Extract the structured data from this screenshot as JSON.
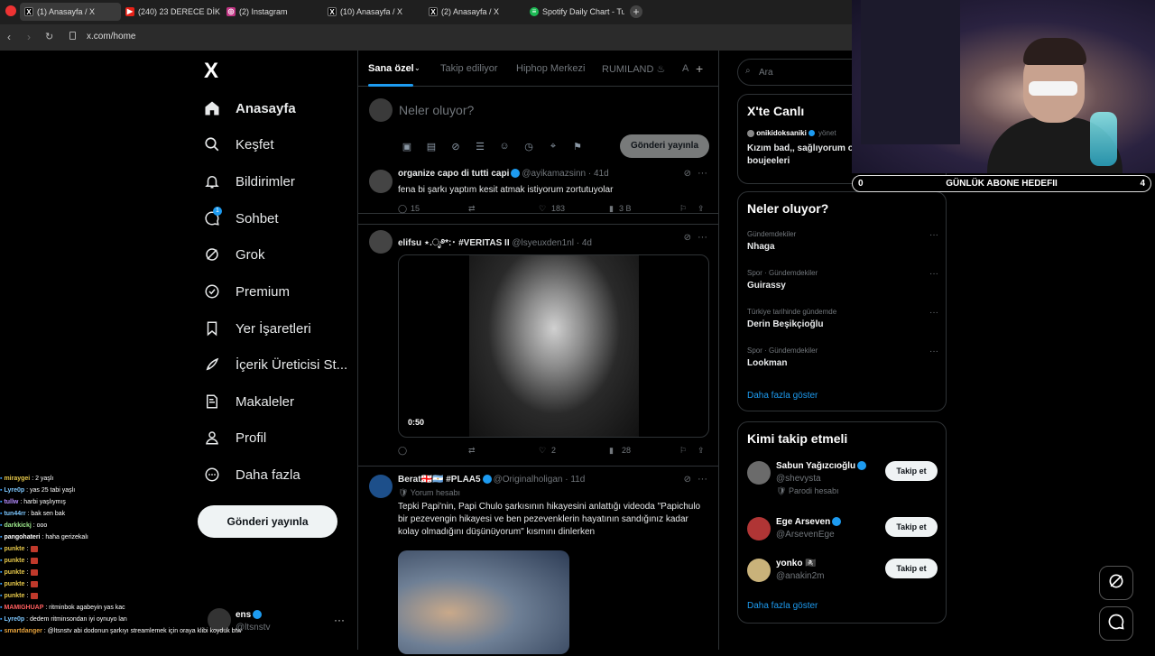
{
  "browser": {
    "tabs": [
      {
        "label": "(1) Anasayfa / X",
        "icon": "x-logo",
        "active": true
      },
      {
        "label": "(240) 23 DERECE DİKİLİTAŞ",
        "icon": "youtube-icon"
      },
      {
        "label": "(2) Instagram",
        "icon": "instagram-icon"
      },
      {
        "label": "(10) Anasayfa / X",
        "icon": "x-logo"
      },
      {
        "label": "(2) Anasayfa / X",
        "icon": "x-logo"
      },
      {
        "label": "Spotify Daily Chart - Turke",
        "icon": "spotify-icon"
      }
    ],
    "url": "x.com/home"
  },
  "nav": {
    "logo": "X",
    "items": [
      {
        "label": "Anasayfa",
        "icon": "home-icon"
      },
      {
        "label": "Keşfet",
        "icon": "search-icon"
      },
      {
        "label": "Bildirimler",
        "icon": "bell-icon"
      },
      {
        "label": "Sohbet",
        "icon": "chat-icon",
        "badge": "1"
      },
      {
        "label": "Grok",
        "icon": "grok-icon"
      },
      {
        "label": "Premium",
        "icon": "premium-icon"
      },
      {
        "label": "Yer İşaretleri",
        "icon": "bookmark-icon"
      },
      {
        "label": "İçerik Üreticisi St...",
        "icon": "rocket-icon"
      },
      {
        "label": "Makaleler",
        "icon": "article-icon"
      },
      {
        "label": "Profil",
        "icon": "person-icon"
      },
      {
        "label": "Daha fazla",
        "icon": "more-circle-icon"
      }
    ],
    "post_button": "Gönderi yayınla",
    "account": {
      "name": "ens",
      "handle": "@ltsnstv",
      "more": "···"
    }
  },
  "feed": {
    "tabs": [
      "Sana özel",
      "Takip ediliyor",
      "Hiphop Merkezi",
      "RUMILAND ♨",
      "A"
    ],
    "compose_placeholder": "Neler oluyor?",
    "compose_post": "Gönderi yayınla",
    "tweets": [
      {
        "name": "organize capo di tutti capi",
        "handle": "@ayikamazsinn · 41d",
        "text": "fena bi şarkı yaptım kesit atmak istiyorum zortutuyolar",
        "replies": "15",
        "retweets": "",
        "likes": "183",
        "views": "3 B"
      },
      {
        "name": "elifsu ⋆.ೃ࿔*:･ #VERITAS II",
        "handle": "@lsyeuxden1nl · 4d",
        "video_duration": "0:50",
        "replies": "",
        "retweets": "",
        "likes": "2",
        "views": "28"
      },
      {
        "name": "Berat🇬🇪🇦🇷 #PLAA5",
        "handle": "@Originalholigan · 11d",
        "sub": "Yorum hesabı",
        "text": "Tepki Papi'nin, Papi Chulo şarkısının hikayesini anlattığı videoda \"Papichulo bir pezevengin hikayesi ve ben pezevenklerin hayatının sandığınız kadar kolay olmadığını düşünüyorum\" kısmını dinlerken"
      }
    ]
  },
  "right": {
    "search_placeholder": "Ara",
    "live": {
      "title": "X'te Canlı",
      "user": "onikidoksaniki",
      "user_suffix": "yönet",
      "text": "Kızım bad,, sağlıyorum o boujeeleri"
    },
    "trends": {
      "title": "Neler oluyor?",
      "items": [
        {
          "context": "Gündemdekiler",
          "name": "Nhaga"
        },
        {
          "context": "Spor · Gündemdekiler",
          "name": "Guirassy"
        },
        {
          "context": "Türkiye tarihinde gündemde",
          "name": "Derin Beşikçioğlu"
        },
        {
          "context": "Spor · Gündemdekiler",
          "name": "Lookman"
        }
      ],
      "more": "Daha fazla göster"
    },
    "who": {
      "title": "Kimi takip etmeli",
      "items": [
        {
          "name": "Sabun Yağızcıoğlu",
          "handle": "@shevysta",
          "note": "Parodi hesabı",
          "button": "Takip et"
        },
        {
          "name": "Ege Arseven",
          "handle": "@ArsevenEge",
          "button": "Takip et"
        },
        {
          "name": "yonko 🏴‍☠️",
          "handle": "@anakin2m",
          "button": "Takip et"
        }
      ],
      "more": "Daha fazla göster"
    }
  },
  "overlay": {
    "goal": {
      "left": "0",
      "label": "GÜNLÜK ABONE HEDEFII",
      "right": "4"
    },
    "chat": [
      {
        "user": "miraygei",
        "msg": ": 2 yaşlı",
        "color": "#e6c84a"
      },
      {
        "user": "Lyre0p",
        "msg": ": yas 25 tabi yaşlı",
        "color": "#7ec8ff"
      },
      {
        "user": "tullw",
        "msg": ": harbi yaşlıymış",
        "color": "#b58cff"
      },
      {
        "user": "tun44rr",
        "msg": ": bak sen bak",
        "color": "#7ec8ff"
      },
      {
        "user": "darkkickj",
        "msg": ": ooo",
        "color": "#9be58a"
      },
      {
        "user": "pangohateri",
        "msg": ": haha gerizekalı",
        "color": "#ffffff"
      },
      {
        "user": "punkte",
        "msg": ":",
        "color": "#e6c84a"
      },
      {
        "user": "punkte",
        "msg": ":",
        "color": "#e6c84a"
      },
      {
        "user": "punkte",
        "msg": ":",
        "color": "#e6c84a"
      },
      {
        "user": "punkte",
        "msg": ":",
        "color": "#e6c84a"
      },
      {
        "user": "punkte",
        "msg": ":",
        "color": "#e6c84a"
      },
      {
        "user": "MAMIGHUAP",
        "msg": ": ritminbok agabeyin yas kac",
        "color": "#ff5e5e"
      },
      {
        "user": "Lyre0p",
        "msg": ": dedem ritminsondan iyi oynuyo lan",
        "color": "#7ec8ff"
      },
      {
        "user": "smartdanger",
        "msg": ": @ltsnstv abi dodonun şarkıyı streamlemek için oraya klibi koyduk btw",
        "color": "#e6a23c"
      }
    ]
  }
}
